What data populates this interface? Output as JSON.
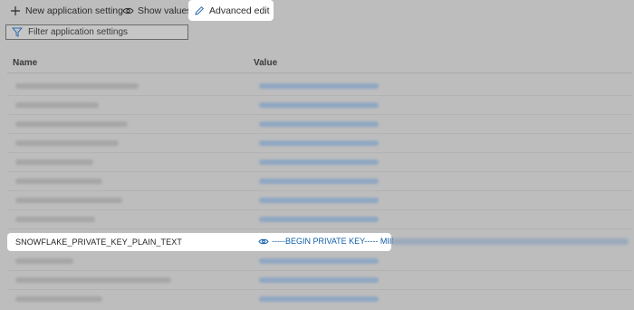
{
  "toolbar": {
    "new_setting_label": "New application setting",
    "show_values_label": "Show values",
    "advanced_edit_label": "Advanced edit"
  },
  "filter": {
    "placeholder": "Filter application settings"
  },
  "table": {
    "columns": {
      "name": "Name",
      "value": "Value"
    },
    "highlighted_row": {
      "name": "SNOWFLAKE_PRIVATE_KEY_PLAIN_TEXT",
      "value": "-----BEGIN PRIVATE KEY----- MIII"
    }
  },
  "colors": {
    "link": "#0f5ea8",
    "overlay": "#bdbdbd",
    "highlight": "#ffffff"
  },
  "icons": {
    "new": "plus-icon",
    "show": "eye-icon",
    "edit": "pencil-icon",
    "filter": "funnel-icon",
    "hidden_value": "eye-hidden-icon"
  }
}
